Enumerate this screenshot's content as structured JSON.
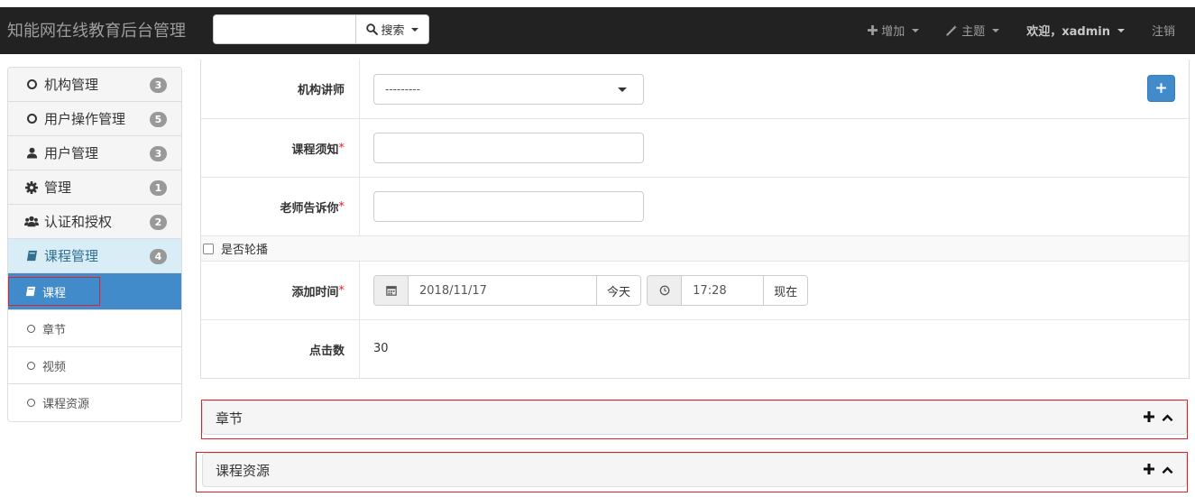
{
  "app": {
    "brand": "知能网在线教育后台管理"
  },
  "search": {
    "placeholder": "",
    "button_label": "搜索"
  },
  "nav": {
    "add": "增加",
    "theme": "主题",
    "welcome": "欢迎，xadmin",
    "logout": "注销"
  },
  "sidebar": {
    "groups": [
      {
        "label": "机构管理",
        "count": "3",
        "icon": "circle-icon"
      },
      {
        "label": "用户操作管理",
        "count": "5",
        "icon": "circle-icon"
      },
      {
        "label": "用户管理",
        "count": "3",
        "icon": "user-icon"
      },
      {
        "label": "管理",
        "count": "1",
        "icon": "gear-icon"
      },
      {
        "label": "认证和授权",
        "count": "2",
        "icon": "users-icon"
      },
      {
        "label": "课程管理",
        "count": "4",
        "icon": "book-icon"
      }
    ],
    "sub_items": [
      {
        "label": "课程",
        "icon": "book-icon"
      },
      {
        "label": "章节",
        "icon": "circle-icon"
      },
      {
        "label": "视频",
        "icon": "circle-icon"
      },
      {
        "label": "课程资源",
        "icon": "circle-icon"
      }
    ]
  },
  "form": {
    "teacher": {
      "label": "机构讲师",
      "value": "---------",
      "add_label": "+"
    },
    "notice": {
      "label": "课程须知",
      "required": "*",
      "value": ""
    },
    "teacher_tell": {
      "label": "老师告诉你",
      "required": "*",
      "value": ""
    },
    "banner": {
      "label": "是否轮播"
    },
    "add_time": {
      "label": "添加时间",
      "required": "*",
      "date": "2018/11/17",
      "today": "今天",
      "time": "17:28",
      "now": "现在"
    },
    "clicks": {
      "label": "点击数",
      "value": "30"
    }
  },
  "inlines": [
    {
      "title": "章节"
    },
    {
      "title": "课程资源"
    }
  ],
  "colors": {
    "navbar": "#222222",
    "primary": "#428bca",
    "highlight": "#e0212c",
    "active_group": "#d9edf7"
  }
}
